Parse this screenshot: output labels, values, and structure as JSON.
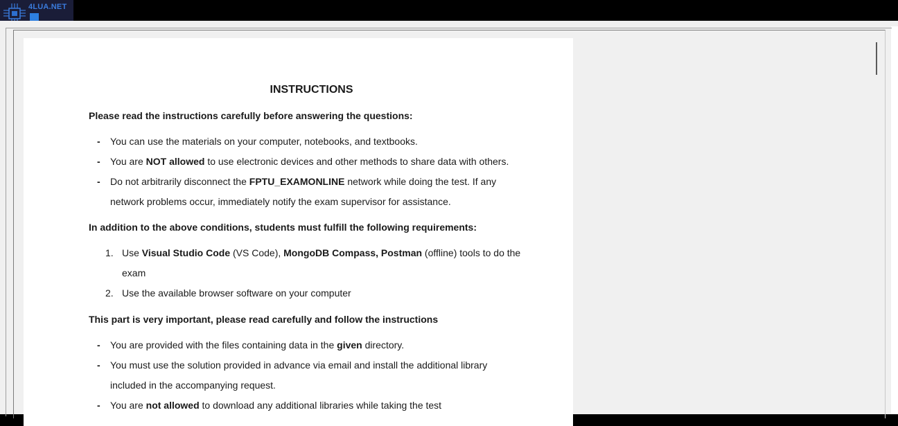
{
  "logo": {
    "text": "4LUA.NET"
  },
  "document": {
    "title": "INSTRUCTIONS",
    "heading1": "Please read the instructions carefully before answering the questions:",
    "bullets1": [
      {
        "parts": [
          "You can use the materials on your computer, notebooks, and textbooks."
        ]
      },
      {
        "parts": [
          "You are ",
          "NOT allowed",
          " to use electronic devices and other methods to share data with others."
        ]
      },
      {
        "line1": [
          "Do not arbitrarily disconnect the ",
          "FPTU_EXAMONLINE",
          " network while doing the test. If any"
        ],
        "line2": "network problems occur, immediately notify the exam supervisor for assistance."
      }
    ],
    "heading2": "In addition to the above conditions, students must fulfill the following requirements:",
    "numbered": [
      {
        "num": "1.",
        "line1": [
          "Use ",
          "Visual Studio Code",
          " (VS Code), ",
          "MongoDB Compass,",
          " ",
          "Postman",
          " (offline) tools to do the"
        ],
        "line2": "exam"
      },
      {
        "num": "2.",
        "text": "Use the available browser software on your computer"
      }
    ],
    "heading3": "This part is very important, please read carefully and follow the instructions",
    "bullets2": [
      {
        "parts": [
          "You are provided with the files containing data in the ",
          "given",
          " directory."
        ]
      },
      {
        "line1": "You must use the solution provided in advance via email and install the additional library",
        "line2": "included in the accompanying request."
      },
      {
        "parts": [
          "You are ",
          "not allowed",
          " to download any additional libraries while taking the test"
        ]
      }
    ],
    "bullet_symbol": "-"
  }
}
